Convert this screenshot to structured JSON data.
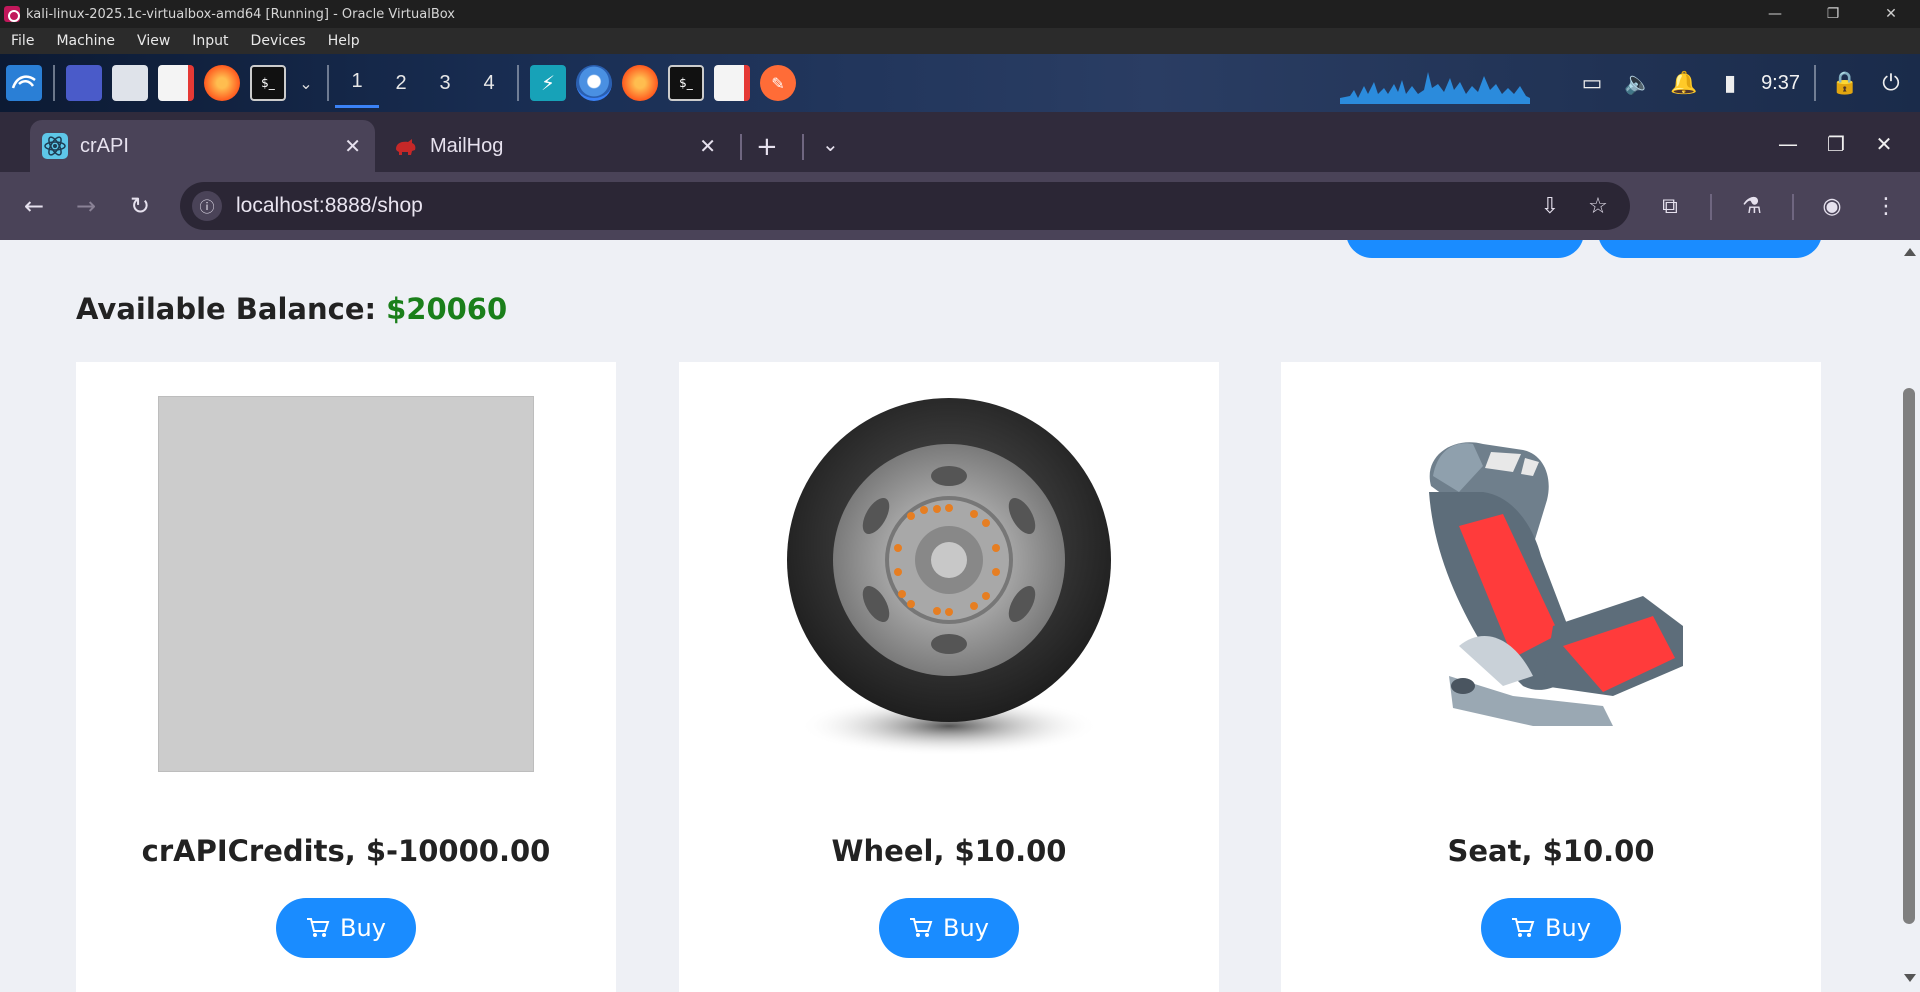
{
  "vbox": {
    "title": "kali-linux-2025.1c-virtualbox-amd64 [Running] - Oracle VirtualBox",
    "menu": [
      "File",
      "Machine",
      "View",
      "Input",
      "Devices",
      "Help"
    ]
  },
  "panel": {
    "workspaces": [
      "1",
      "2",
      "3",
      "4"
    ],
    "active_workspace": "1",
    "clock": "9:37"
  },
  "browser": {
    "tabs": [
      {
        "label": "crAPI",
        "icon": "react-icon",
        "active": true
      },
      {
        "label": "MailHog",
        "icon": "mailhog-pig-icon",
        "active": false
      }
    ],
    "url": "localhost:8888/shop"
  },
  "shop": {
    "balance_label": "Available Balance:",
    "balance_value": "$20060",
    "products": [
      {
        "title": "crAPICredits, $-10000.00",
        "image": "placeholder-image",
        "buy_label": "Buy"
      },
      {
        "title": "Wheel, $10.00",
        "image": "wheel-image",
        "buy_label": "Buy"
      },
      {
        "title": "Seat, $10.00",
        "image": "seat-image",
        "buy_label": "Buy"
      }
    ]
  },
  "colors": {
    "accent_blue": "#1a8cff",
    "balance_green": "#1a7f1a",
    "tab_bar": "#302b3c",
    "toolbar": "#4a4358"
  }
}
